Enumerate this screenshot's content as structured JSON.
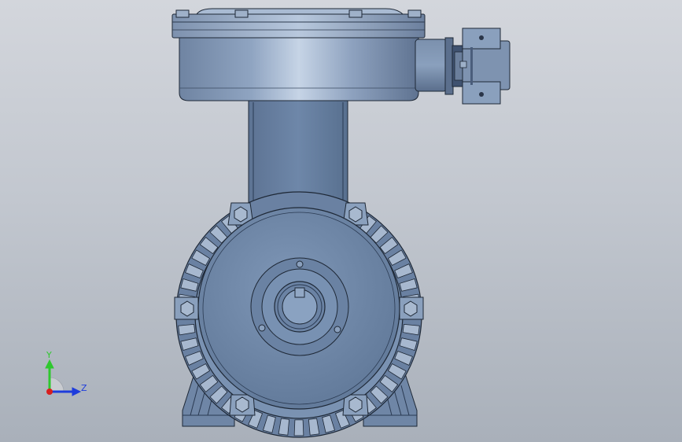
{
  "viewport": {
    "background_top": "#d3d6dc",
    "background_bottom": "#a9b0ba"
  },
  "model": {
    "body_color": "#7e95b3",
    "body_highlight": "#c6d4e6",
    "outline_color": "#1e2836"
  },
  "triad": {
    "y_label": "Y",
    "z_label": "Z",
    "y_color": "#2ec82e",
    "z_color": "#1e3cdc",
    "x_color": "#d81e1e"
  }
}
